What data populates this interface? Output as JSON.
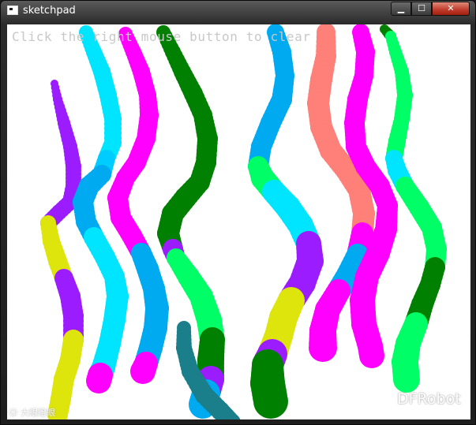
{
  "window": {
    "title": "sketchpad",
    "controls": {
      "minimize": "▁",
      "maximize": "☐",
      "close": "✕"
    }
  },
  "canvas": {
    "hint_text": "Click the right mouse button to clear"
  },
  "strokes": [
    {
      "color": "#9b1cff",
      "points": [
        [
          60,
          75,
          5
        ],
        [
          64,
          95,
          6
        ],
        [
          72,
          125,
          8
        ],
        [
          80,
          155,
          9
        ],
        [
          84,
          180,
          10
        ],
        [
          84,
          205,
          10
        ],
        [
          80,
          225,
          10
        ],
        [
          66,
          238,
          10
        ],
        [
          52,
          252,
          10
        ]
      ]
    },
    {
      "color": "#dde50c",
      "points": [
        [
          52,
          252,
          10
        ],
        [
          56,
          275,
          11
        ],
        [
          64,
          300,
          12
        ],
        [
          72,
          322,
          12
        ]
      ]
    },
    {
      "color": "#9b1cff",
      "points": [
        [
          72,
          322,
          12
        ],
        [
          80,
          345,
          13
        ],
        [
          84,
          370,
          13
        ],
        [
          84,
          400,
          13
        ]
      ]
    },
    {
      "color": "#dde50c",
      "points": [
        [
          84,
          400,
          13
        ],
        [
          80,
          425,
          13
        ],
        [
          72,
          450,
          13
        ],
        [
          68,
          475,
          13
        ],
        [
          64,
          495,
          13
        ]
      ]
    },
    {
      "color": "#00e5ff",
      "points": [
        [
          100,
          10,
          9
        ],
        [
          110,
          35,
          10
        ],
        [
          120,
          60,
          11
        ],
        [
          128,
          90,
          11
        ],
        [
          134,
          120,
          11
        ],
        [
          134,
          150,
          11
        ],
        [
          126,
          170,
          11
        ]
      ]
    },
    {
      "color": "#00ccff",
      "points": [
        [
          126,
          170,
          11
        ],
        [
          120,
          190,
          12
        ]
      ]
    },
    {
      "color": "#00aaf0",
      "points": [
        [
          120,
          190,
          12
        ],
        [
          104,
          205,
          13
        ],
        [
          96,
          225,
          13
        ],
        [
          100,
          250,
          13
        ],
        [
          110,
          270,
          13
        ]
      ]
    },
    {
      "color": "#00e5ff",
      "points": [
        [
          110,
          270,
          13
        ],
        [
          124,
          295,
          13
        ],
        [
          136,
          320,
          13
        ],
        [
          140,
          345,
          14
        ],
        [
          136,
          375,
          14
        ],
        [
          130,
          405,
          14
        ],
        [
          122,
          435,
          15
        ],
        [
          118,
          445,
          16
        ]
      ]
    },
    {
      "color": "#ff00ff",
      "points": [
        [
          118,
          445,
          16
        ],
        [
          116,
          452,
          16
        ]
      ]
    },
    {
      "color": "#ff00ff",
      "points": [
        [
          150,
          12,
          9
        ],
        [
          160,
          35,
          10
        ],
        [
          170,
          60,
          11
        ],
        [
          178,
          90,
          11
        ],
        [
          180,
          115,
          12
        ],
        [
          176,
          145,
          12
        ],
        [
          164,
          175,
          12
        ],
        [
          150,
          195,
          12
        ],
        [
          140,
          220,
          13
        ],
        [
          144,
          245,
          13
        ],
        [
          158,
          268,
          13
        ],
        [
          170,
          290,
          13
        ]
      ]
    },
    {
      "color": "#00aaf0",
      "points": [
        [
          170,
          290,
          13
        ],
        [
          178,
          310,
          14
        ],
        [
          186,
          335,
          14
        ],
        [
          190,
          360,
          15
        ],
        [
          188,
          385,
          15
        ],
        [
          182,
          410,
          15
        ],
        [
          176,
          430,
          15
        ]
      ]
    },
    {
      "color": "#ff00ff",
      "points": [
        [
          176,
          430,
          15
        ],
        [
          172,
          440,
          16
        ]
      ]
    },
    {
      "color": "#008000",
      "points": [
        [
          198,
          10,
          9
        ],
        [
          210,
          35,
          10
        ],
        [
          222,
          60,
          11
        ],
        [
          236,
          88,
          12
        ],
        [
          248,
          115,
          12
        ],
        [
          254,
          145,
          13
        ],
        [
          252,
          175,
          13
        ],
        [
          244,
          200,
          13
        ],
        [
          226,
          220,
          14
        ],
        [
          210,
          240,
          14
        ],
        [
          204,
          265,
          14
        ],
        [
          210,
          285,
          13
        ]
      ]
    },
    {
      "color": "#9b1cff",
      "points": [
        [
          210,
          285,
          13
        ],
        [
          214,
          296,
          12
        ]
      ]
    },
    {
      "color": "#00ff66",
      "points": [
        [
          214,
          296,
          12
        ],
        [
          230,
          320,
          14
        ],
        [
          246,
          345,
          15
        ],
        [
          256,
          375,
          16
        ],
        [
          260,
          400,
          16
        ]
      ]
    },
    {
      "color": "#008000",
      "points": [
        [
          260,
          400,
          16
        ],
        [
          258,
          425,
          17
        ],
        [
          258,
          450,
          17
        ]
      ]
    },
    {
      "color": "#9b1cff",
      "points": [
        [
          258,
          450,
          17
        ],
        [
          252,
          468,
          18
        ]
      ]
    },
    {
      "color": "#00aaf0",
      "points": [
        [
          252,
          468,
          18
        ],
        [
          248,
          482,
          18
        ]
      ]
    },
    {
      "color": "#1a7f8a",
      "points": [
        [
          224,
          385,
          9
        ],
        [
          224,
          410,
          10
        ],
        [
          232,
          440,
          11
        ],
        [
          250,
          470,
          12
        ],
        [
          270,
          490,
          12
        ],
        [
          284,
          505,
          12
        ]
      ]
    },
    {
      "color": "#00aaf0",
      "points": [
        [
          340,
          10,
          11
        ],
        [
          348,
          35,
          12
        ],
        [
          352,
          65,
          12
        ],
        [
          348,
          95,
          13
        ],
        [
          334,
          125,
          13
        ],
        [
          322,
          155,
          13
        ],
        [
          318,
          180,
          13
        ]
      ]
    },
    {
      "color": "#00ff66",
      "points": [
        [
          318,
          180,
          13
        ],
        [
          324,
          195,
          15
        ],
        [
          338,
          212,
          15
        ]
      ]
    },
    {
      "color": "#00e5ff",
      "points": [
        [
          338,
          212,
          15
        ],
        [
          356,
          232,
          16
        ],
        [
          372,
          255,
          16
        ],
        [
          382,
          278,
          16
        ]
      ]
    },
    {
      "color": "#9b1cff",
      "points": [
        [
          382,
          278,
          16
        ],
        [
          384,
          300,
          17
        ],
        [
          374,
          328,
          17
        ],
        [
          360,
          350,
          17
        ]
      ]
    },
    {
      "color": "#dde50c",
      "points": [
        [
          360,
          350,
          17
        ],
        [
          350,
          372,
          18
        ],
        [
          344,
          395,
          18
        ],
        [
          336,
          418,
          19
        ]
      ]
    },
    {
      "color": "#9b1cff",
      "points": [
        [
          336,
          418,
          19
        ],
        [
          330,
          432,
          20
        ]
      ]
    },
    {
      "color": "#008000",
      "points": [
        [
          330,
          432,
          20
        ],
        [
          330,
          455,
          22
        ],
        [
          334,
          478,
          22
        ]
      ]
    },
    {
      "color": "#ff7f79",
      "points": [
        [
          404,
          10,
          12
        ],
        [
          404,
          40,
          13
        ],
        [
          398,
          70,
          14
        ],
        [
          394,
          100,
          14
        ],
        [
          398,
          130,
          14
        ],
        [
          410,
          160,
          14
        ],
        [
          430,
          185,
          14
        ],
        [
          446,
          210,
          14
        ],
        [
          452,
          240,
          14
        ],
        [
          450,
          265,
          14
        ]
      ]
    },
    {
      "color": "#ff00ff",
      "points": [
        [
          450,
          265,
          14
        ],
        [
          444,
          292,
          14
        ]
      ]
    },
    {
      "color": "#00aaf0",
      "points": [
        [
          444,
          292,
          14
        ],
        [
          432,
          318,
          15
        ],
        [
          420,
          338,
          15
        ]
      ]
    },
    {
      "color": "#ff00ff",
      "points": [
        [
          420,
          338,
          15
        ],
        [
          406,
          362,
          16
        ],
        [
          400,
          388,
          17
        ],
        [
          400,
          410,
          18
        ]
      ]
    },
    {
      "color": "#ff00ff",
      "points": [
        [
          448,
          10,
          11
        ],
        [
          454,
          35,
          12
        ],
        [
          452,
          65,
          12
        ],
        [
          444,
          95,
          13
        ],
        [
          440,
          125,
          13
        ],
        [
          442,
          155,
          13
        ],
        [
          454,
          180,
          13
        ],
        [
          472,
          205,
          13
        ],
        [
          482,
          230,
          13
        ],
        [
          480,
          260,
          14
        ],
        [
          470,
          290,
          15
        ],
        [
          456,
          320,
          15
        ],
        [
          450,
          350,
          16
        ],
        [
          452,
          380,
          16
        ],
        [
          460,
          408,
          16
        ],
        [
          462,
          420,
          16
        ]
      ]
    },
    {
      "color": "#008000",
      "points": [
        [
          478,
          6,
          6
        ],
        [
          486,
          15,
          7
        ]
      ]
    },
    {
      "color": "#00ff66",
      "points": [
        [
          486,
          15,
          7
        ],
        [
          492,
          35,
          8
        ],
        [
          500,
          60,
          9
        ],
        [
          504,
          90,
          10
        ],
        [
          500,
          120,
          10
        ],
        [
          494,
          148,
          11
        ],
        [
          490,
          170,
          11
        ]
      ]
    },
    {
      "color": "#00e5ff",
      "points": [
        [
          490,
          170,
          11
        ],
        [
          494,
          185,
          12
        ],
        [
          504,
          205,
          12
        ]
      ]
    },
    {
      "color": "#00ff66",
      "points": [
        [
          504,
          205,
          12
        ],
        [
          522,
          232,
          13
        ],
        [
          538,
          258,
          13
        ],
        [
          544,
          285,
          13
        ],
        [
          542,
          308,
          13
        ]
      ]
    },
    {
      "color": "#008000",
      "points": [
        [
          542,
          308,
          13
        ],
        [
          536,
          330,
          13
        ],
        [
          526,
          355,
          14
        ],
        [
          518,
          380,
          15
        ]
      ]
    },
    {
      "color": "#00ff66",
      "points": [
        [
          518,
          380,
          15
        ],
        [
          508,
          405,
          16
        ],
        [
          504,
          428,
          17
        ],
        [
          506,
          450,
          17
        ]
      ]
    }
  ],
  "watermarks": {
    "left": "☺ 大眼瞪眼",
    "right": "DFRobot"
  }
}
